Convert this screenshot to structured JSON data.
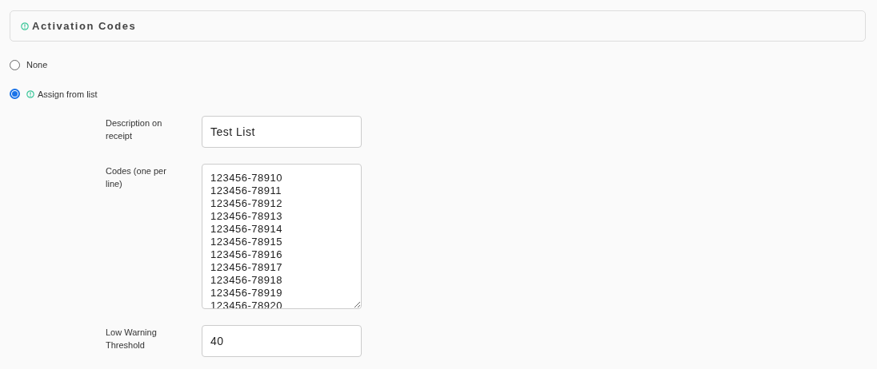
{
  "section": {
    "title": "Activation Codes"
  },
  "options": [
    {
      "label": "None",
      "selected": false,
      "info": false
    },
    {
      "label": "Assign from list",
      "selected": true,
      "info": true
    }
  ],
  "fields": [
    {
      "kind": "input",
      "label": "Description on receipt",
      "value": "Test List"
    },
    {
      "kind": "textarea",
      "label": "Codes (one per line)",
      "value": "123456-78910\n123456-78911\n123456-78912\n123456-78913\n123456-78914\n123456-78915\n123456-78916\n123456-78917\n123456-78918\n123456-78919\n123456-78920"
    },
    {
      "kind": "input",
      "label": "Low Warning Threshold",
      "value": "40"
    }
  ]
}
